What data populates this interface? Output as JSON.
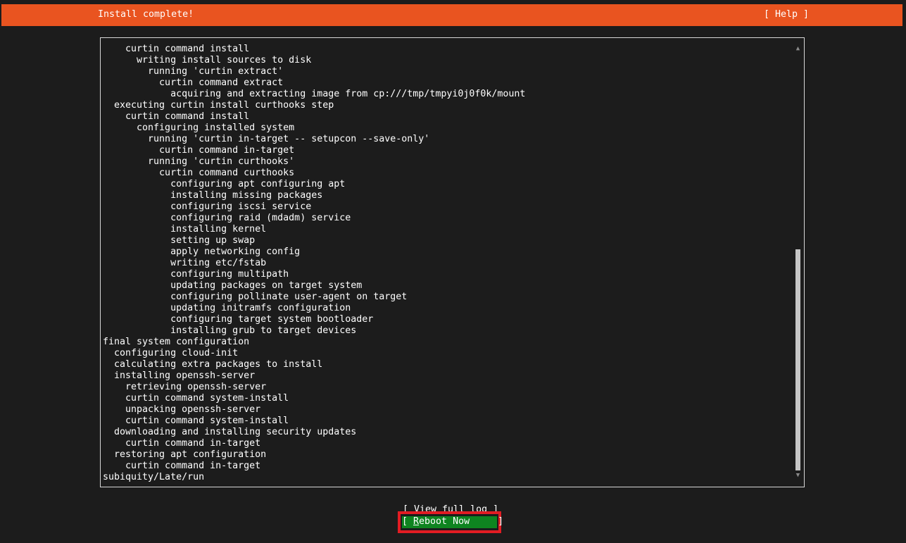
{
  "header": {
    "title": "Install complete!",
    "help_label": "[ Help ]"
  },
  "log": {
    "lines": [
      "    curtin command install",
      "      writing install sources to disk",
      "        running 'curtin extract'",
      "          curtin command extract",
      "            acquiring and extracting image from cp:///tmp/tmpyi0j0f0k/mount",
      "  executing curtin install curthooks step",
      "    curtin command install",
      "      configuring installed system",
      "        running 'curtin in-target -- setupcon --save-only'",
      "          curtin command in-target",
      "        running 'curtin curthooks'",
      "          curtin command curthooks",
      "            configuring apt configuring apt",
      "            installing missing packages",
      "            configuring iscsi service",
      "            configuring raid (mdadm) service",
      "            installing kernel",
      "            setting up swap",
      "            apply networking config",
      "            writing etc/fstab",
      "            configuring multipath",
      "            updating packages on target system",
      "            configuring pollinate user-agent on target",
      "            updating initramfs configuration",
      "            configuring target system bootloader",
      "            installing grub to target devices",
      "final system configuration",
      "  configuring cloud-init",
      "  calculating extra packages to install",
      "  installing openssh-server",
      "    retrieving openssh-server",
      "    curtin command system-install",
      "    unpacking openssh-server",
      "    curtin command system-install",
      "  downloading and installing security updates",
      "    curtin command in-target",
      "  restoring apt configuration",
      "    curtin command in-target",
      "subiquity/Late/run"
    ],
    "scroll_position": 0.47,
    "scroll_visible_fraction": 0.53
  },
  "buttons": {
    "view_log_label": "[ View full log ]",
    "reboot_prefix": "[ ",
    "reboot_hotkey": "R",
    "reboot_rest": "eboot Now     ]"
  },
  "colors": {
    "header_bg": "#e95420",
    "reboot_bg": "#0e8420",
    "highlight_border": "#e21c23"
  }
}
